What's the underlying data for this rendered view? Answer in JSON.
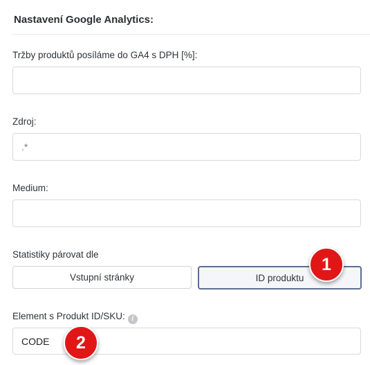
{
  "section": {
    "title": "Nastavení Google Analytics:"
  },
  "fields": {
    "revenue": {
      "label": "Tržby produktů posíláme do GA4 s DPH [%]:",
      "value": "",
      "placeholder": ""
    },
    "source": {
      "label": "Zdroj:",
      "value": "",
      "placeholder": ".*"
    },
    "medium": {
      "label": "Medium:",
      "value": "",
      "placeholder": ""
    },
    "pairing": {
      "label": "Statistiky párovat dle",
      "options": [
        "Vstupní stránky",
        "ID produktu"
      ],
      "selected": "ID produktu"
    },
    "element": {
      "label": "Element s Produkt ID/SKU:",
      "value": "CODE",
      "info_icon": "info-icon"
    }
  },
  "markers": [
    "1",
    "2"
  ],
  "colors": {
    "marker": "#e11717",
    "selected_border": "#5b6f8e"
  }
}
